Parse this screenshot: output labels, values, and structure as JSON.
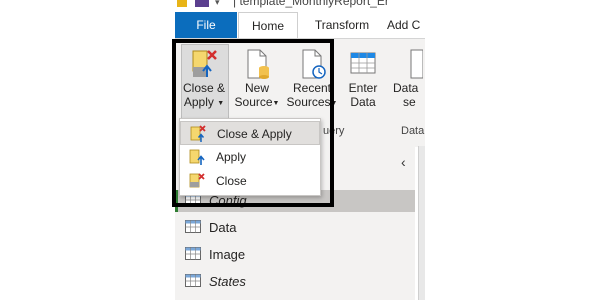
{
  "window": {
    "title": "| template_MonthlyReport_Er"
  },
  "tabs": {
    "file": "File",
    "home": "Home",
    "transform": "Transform",
    "add_column": "Add C"
  },
  "ribbon": {
    "close_apply": {
      "line1": "Close &",
      "line2": "Apply"
    },
    "new_source": {
      "line1": "New",
      "line2": "Source"
    },
    "recent_sources": {
      "line1": "Recent",
      "line2": "Sources"
    },
    "enter_data": {
      "line1": "Enter",
      "line2": "Data"
    },
    "data_source_settings": {
      "line1": "Data",
      "line2": "se"
    },
    "group_query_label": "uery",
    "group_data_label": "Data"
  },
  "dropdown": {
    "items": [
      {
        "label": "Close & Apply",
        "icon": "close-apply-icon"
      },
      {
        "label": "Apply",
        "icon": "apply-icon"
      },
      {
        "label": "Close",
        "icon": "close-icon"
      }
    ]
  },
  "queries": {
    "collapse_glyph": "‹",
    "items": [
      {
        "label": "Config",
        "italic": true,
        "selected": true
      },
      {
        "label": "Data",
        "italic": false,
        "selected": false
      },
      {
        "label": "Image",
        "italic": false,
        "selected": false
      },
      {
        "label": "States",
        "italic": true,
        "selected": false
      }
    ]
  },
  "colors": {
    "file_tab": "#0b6dbd",
    "highlight_border": "#000000",
    "ribbon_bg": "#f3f2f1",
    "selection": "#c8c6c4"
  }
}
